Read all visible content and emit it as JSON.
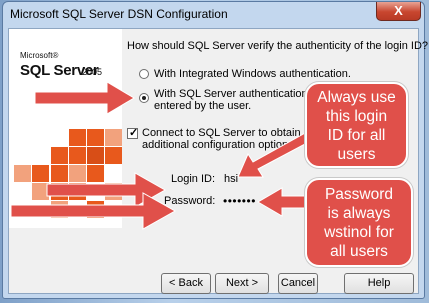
{
  "window": {
    "title": "Microsoft SQL Server DSN Configuration",
    "close_glyph": "X"
  },
  "logo": {
    "brand": "Microsoft®",
    "product": "SQL Server",
    "version": "2005"
  },
  "question": "How should SQL Server verify the authenticity of the login ID?",
  "auth_options": [
    {
      "label": "With Integrated Windows authentication.",
      "selected": false
    },
    {
      "label_line1": "With SQL Server authentication using a lo",
      "label_line2": "entered by the user.",
      "selected": true
    }
  ],
  "connect_option": {
    "line1": "Connect to SQL Server to obtain default setti",
    "line2": "additional configuration options.",
    "checked": true
  },
  "credentials": {
    "login_label": "Login ID:",
    "login_value": "hsi",
    "password_label": "Password:",
    "password_value": "•••••••"
  },
  "buttons": {
    "back": "< Back",
    "next": "Next >",
    "cancel": "Cancel",
    "help": "Help"
  },
  "callouts": {
    "login": [
      "Always use",
      "this login",
      "ID for all",
      "users"
    ],
    "password": [
      "Password",
      "is always",
      "wstinol for",
      "all users"
    ]
  },
  "colors": {
    "callout": "#e0504a",
    "logo_orange": "#e8591c",
    "logo_light": "#f2a27d",
    "close_button": "#c8462f"
  }
}
